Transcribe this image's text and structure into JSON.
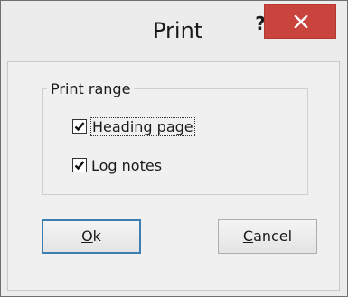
{
  "window": {
    "title": "Print",
    "help_label": "?",
    "close_label": "×"
  },
  "group": {
    "label": "Print range"
  },
  "checkboxes": [
    {
      "label": "Heading page",
      "checked": true
    },
    {
      "label": "Log notes",
      "checked": true
    }
  ],
  "buttons": {
    "ok": {
      "mnemonic": "O",
      "rest": "k"
    },
    "cancel": {
      "mnemonic": "C",
      "rest": "ancel"
    }
  }
}
